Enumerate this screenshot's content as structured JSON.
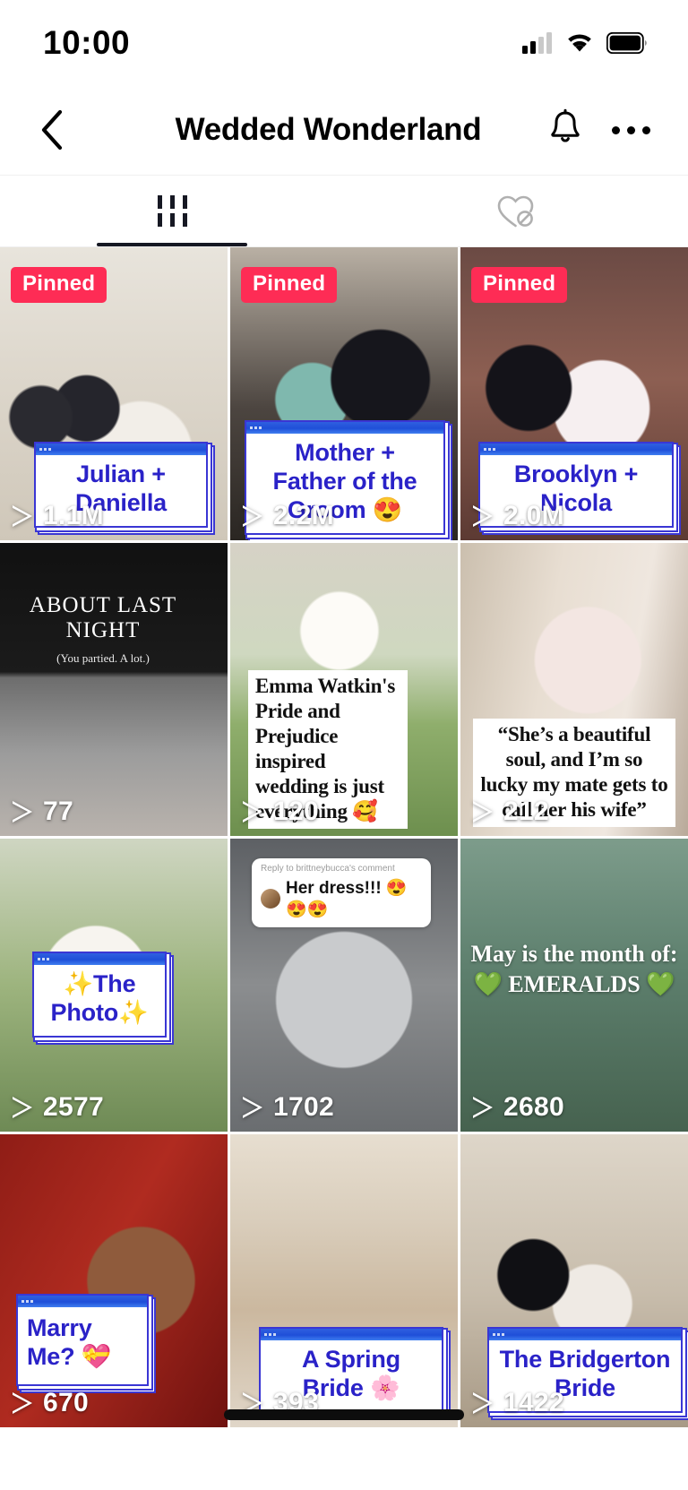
{
  "status_bar": {
    "time": "10:00",
    "cellular_icon": "cellular-signal-icon",
    "wifi_icon": "wifi-icon",
    "battery_icon": "battery-icon"
  },
  "nav": {
    "back_icon": "chevron-left-icon",
    "title": "Wedded Wonderland",
    "bell_icon": "bell-icon",
    "more_icon": "more-options-icon"
  },
  "tabs": [
    {
      "id": "videos",
      "icon": "grid-bars-icon",
      "active": true
    },
    {
      "id": "liked",
      "icon": "heart-hidden-icon",
      "active": false
    }
  ],
  "colors": {
    "accent_pinned": "#fe2c55",
    "caption_blue": "#2a22c8",
    "window_bar_blue": "#1f4fd8",
    "text_primary": "#161823"
  },
  "labels": {
    "pinned": "Pinned",
    "play_icon": "play-triangle-icon"
  },
  "videos": [
    {
      "id": "v1",
      "pinned": true,
      "views": "1.1M",
      "caption": "Julian + Daniella",
      "caption_style": "window"
    },
    {
      "id": "v2",
      "pinned": true,
      "views": "2.2M",
      "caption": "Mother + Father of the Groom 😍",
      "caption_style": "window"
    },
    {
      "id": "v3",
      "pinned": true,
      "views": "2.0M",
      "caption": "Brooklyn + Nicola",
      "caption_style": "window"
    },
    {
      "id": "v4",
      "pinned": false,
      "views": "77",
      "caption": "ABOUT LAST NIGHT",
      "caption_sub": "(You partied. A lot.)",
      "caption_style": "screen-title"
    },
    {
      "id": "v5",
      "pinned": false,
      "views": "120",
      "caption": "Emma Watkin's Pride and Prejudice inspired wedding is just everything 🥰",
      "caption_style": "serif"
    },
    {
      "id": "v6",
      "pinned": false,
      "views": "212",
      "caption": "“She’s a beautiful soul, and I’m so lucky my mate gets to call her his wife”",
      "caption_style": "serif"
    },
    {
      "id": "v7",
      "pinned": false,
      "views": "2577",
      "caption": "✨The Photo✨",
      "caption_style": "window"
    },
    {
      "id": "v8",
      "pinned": false,
      "views": "1702",
      "caption": "Her dress!!! 😍😍😍",
      "caption_reply_to": "Reply to brittneybucca's comment",
      "caption_style": "reply"
    },
    {
      "id": "v9",
      "pinned": false,
      "views": "2680",
      "caption_line1": "May is the month of:",
      "caption_line2": "💚 EMERALDS 💚",
      "caption_style": "emerald"
    },
    {
      "id": "v10",
      "pinned": false,
      "views": "670",
      "caption": "Marry Me? 💝",
      "caption_style": "window"
    },
    {
      "id": "v11",
      "pinned": false,
      "views": "393",
      "caption": "A Spring Bride 🌸",
      "caption_style": "window"
    },
    {
      "id": "v12",
      "pinned": false,
      "views": "1422",
      "caption": "The Bridgerton Bride",
      "caption_style": "window"
    }
  ]
}
